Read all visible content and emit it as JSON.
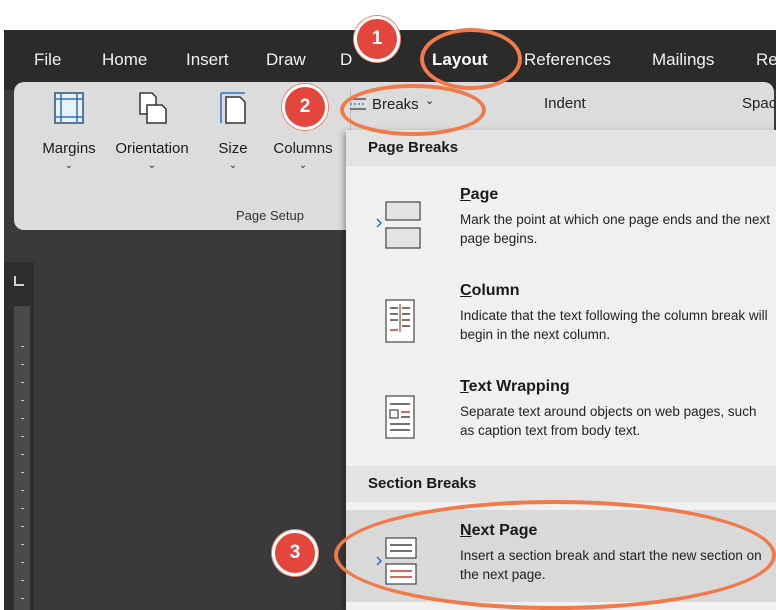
{
  "menubar": {
    "tabs": [
      "File",
      "Home",
      "Insert",
      "Draw",
      "D",
      "Layout",
      "References",
      "Mailings",
      "Re"
    ]
  },
  "ribbon": {
    "buttons": [
      {
        "label": "Margins",
        "icon": "margins-icon"
      },
      {
        "label": "Orientation",
        "icon": "orientation-icon"
      },
      {
        "label": "Size",
        "icon": "size-icon"
      },
      {
        "label": "Columns",
        "icon": "columns-icon"
      }
    ],
    "group_label": "Page Setup",
    "breaks_label": "Breaks",
    "indent_label": "Indent",
    "spacing_label": "Spac"
  },
  "dropdown": {
    "page_breaks_header": "Page Breaks",
    "section_breaks_header": "Section Breaks",
    "items": [
      {
        "key": "P",
        "rest": "age",
        "desc": "Mark the point at which one page ends and the next page begins.",
        "icon": "page-break-icon"
      },
      {
        "key": "C",
        "rest": "olumn",
        "desc": "Indicate that the text following the column break will begin in the next column.",
        "icon": "column-break-icon"
      },
      {
        "key": "T",
        "rest": "ext Wrapping",
        "desc": "Separate text around objects on web pages, such as caption text from body text.",
        "icon": "text-wrapping-icon"
      },
      {
        "key": "N",
        "rest": "ext Page",
        "desc": "Insert a section break and start the new section on the next page.",
        "icon": "next-page-icon"
      }
    ]
  },
  "annotations": {
    "badge1": "1",
    "badge2": "2",
    "badge3": "3"
  },
  "colors": {
    "accent_ring": "#f07a4a",
    "badge": "#e4463e",
    "ribbon_bg": "#dcdcdc",
    "dark_bg": "#2b2b2b"
  }
}
